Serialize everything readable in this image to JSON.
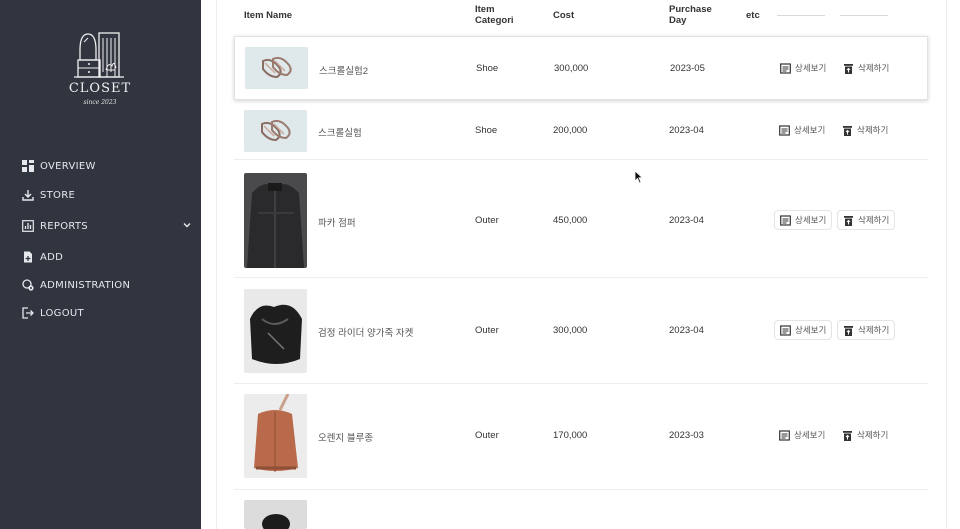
{
  "brand": {
    "name": "CLOSET",
    "tagline": "since 2023"
  },
  "sidebar": {
    "items": [
      {
        "label": "OVERVIEW",
        "icon": "dashboard-icon"
      },
      {
        "label": "STORE",
        "icon": "download-icon"
      },
      {
        "label": "REPORTS",
        "icon": "chart-icon",
        "has_dropdown": true
      },
      {
        "label": "ADD",
        "icon": "add-file-icon"
      },
      {
        "label": "ADMINISTRATION",
        "icon": "admin-gear-icon"
      },
      {
        "label": "LOGOUT",
        "icon": "logout-icon"
      }
    ]
  },
  "table": {
    "columns": [
      "Item Name",
      "Item\nCategori",
      "Cost",
      "Purchase\nDay",
      "etc"
    ],
    "col_name": "Item Name",
    "col_category_1": "Item",
    "col_category_2": "Categori",
    "col_cost": "Cost",
    "col_purchase_1": "Purchase",
    "col_purchase_2": "Day",
    "col_etc": "etc",
    "detail_label": "상세보기",
    "delete_label": "삭제하기",
    "rows": [
      {
        "name": "스크롤실험2",
        "category": "Shoe",
        "cost": "300,000",
        "date": "2023-05",
        "thumb": "sandals"
      },
      {
        "name": "스크롤실험",
        "category": "Shoe",
        "cost": "200,000",
        "date": "2023-04",
        "thumb": "sandals"
      },
      {
        "name": "파카 점퍼",
        "category": "Outer",
        "cost": "450,000",
        "date": "2023-04",
        "thumb": "parka"
      },
      {
        "name": "검정 라이더 양가죽 자켓",
        "category": "Outer",
        "cost": "300,000",
        "date": "2023-04",
        "thumb": "leather"
      },
      {
        "name": "오렌지 블루종",
        "category": "Outer",
        "cost": "170,000",
        "date": "2023-03",
        "thumb": "blouson"
      },
      {
        "name": "",
        "category": "",
        "cost": "",
        "date": "",
        "thumb": "black"
      }
    ]
  },
  "colors": {
    "sidebar_bg": "#30353f",
    "sidebar_text": "#e6e8ec",
    "accent": "#333333"
  }
}
